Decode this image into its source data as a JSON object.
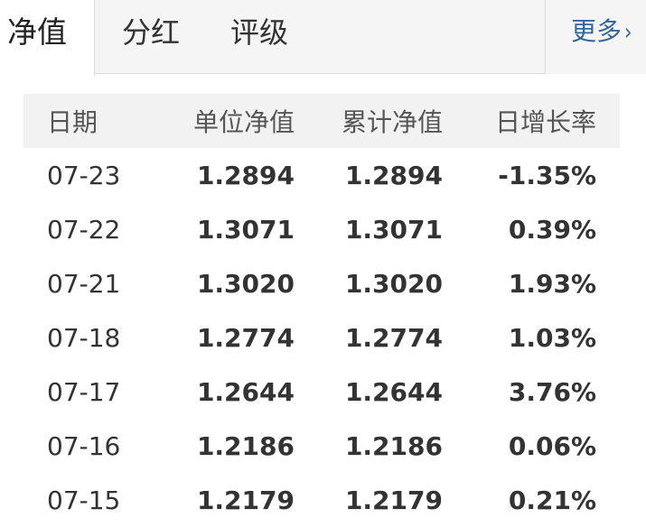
{
  "tabs": [
    {
      "label": "净值",
      "active": true
    },
    {
      "label": "分红",
      "active": false
    },
    {
      "label": "评级",
      "active": false
    }
  ],
  "more": {
    "label": "更多",
    "arrow": "›"
  },
  "table": {
    "headers": [
      "日期",
      "单位净值",
      "累计净值",
      "日增长率"
    ],
    "rows": [
      {
        "date": "07-23",
        "unit": "1.2894",
        "acc": "1.2894",
        "rate": "-1.35%",
        "trend": "down"
      },
      {
        "date": "07-22",
        "unit": "1.3071",
        "acc": "1.3071",
        "rate": "0.39%",
        "trend": "up"
      },
      {
        "date": "07-21",
        "unit": "1.3020",
        "acc": "1.3020",
        "rate": "1.93%",
        "trend": "up"
      },
      {
        "date": "07-18",
        "unit": "1.2774",
        "acc": "1.2774",
        "rate": "1.03%",
        "trend": "up"
      },
      {
        "date": "07-17",
        "unit": "1.2644",
        "acc": "1.2644",
        "rate": "3.76%",
        "trend": "up"
      },
      {
        "date": "07-16",
        "unit": "1.2186",
        "acc": "1.2186",
        "rate": "0.06%",
        "trend": "up"
      },
      {
        "date": "07-15",
        "unit": "1.2179",
        "acc": "1.2179",
        "rate": "0.21%",
        "trend": "up"
      }
    ]
  },
  "colors": {
    "down": "#008800",
    "up": "#ee0000",
    "link": "#336699"
  }
}
